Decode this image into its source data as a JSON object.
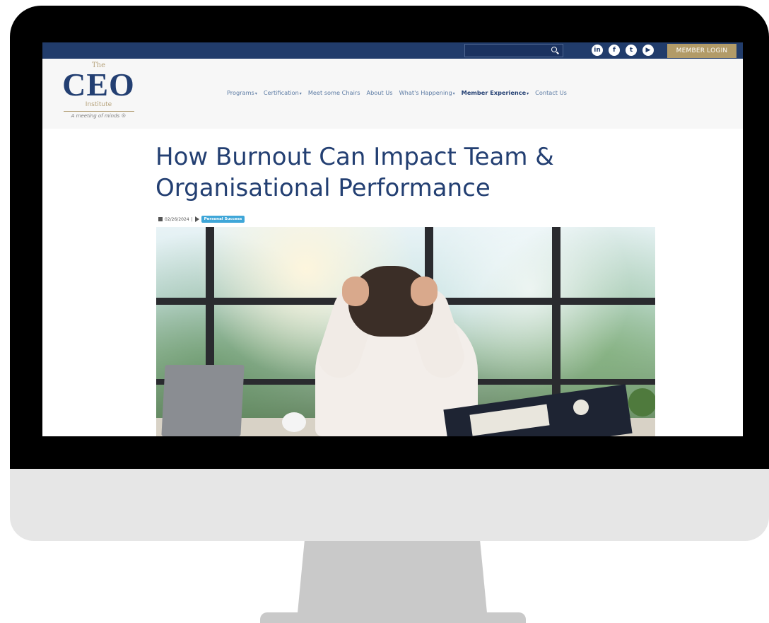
{
  "screen": {
    "search": {
      "placeholder": ""
    },
    "social_icons": [
      {
        "name": "linkedin-icon",
        "glyph": "in"
      },
      {
        "name": "facebook-icon",
        "glyph": "f"
      },
      {
        "name": "twitter-icon",
        "glyph": "t"
      },
      {
        "name": "youtube-icon",
        "glyph": "▶"
      }
    ],
    "member_login_label": "MEMBER LOGIN",
    "logo": {
      "the": "The",
      "ceo": "CEO",
      "institute": "Institute",
      "tagline": "A meeting of minds ®"
    },
    "nav": [
      {
        "label": "Programs",
        "dropdown": true,
        "strong": false
      },
      {
        "label": "Certification",
        "dropdown": true,
        "strong": false
      },
      {
        "label": "Meet some Chairs",
        "dropdown": false,
        "strong": false
      },
      {
        "label": "About Us",
        "dropdown": false,
        "strong": false
      },
      {
        "label": "What's Happening",
        "dropdown": true,
        "strong": false
      },
      {
        "label": "Member Experience",
        "dropdown": true,
        "strong": true
      },
      {
        "label": "Contact Us",
        "dropdown": false,
        "strong": false
      }
    ],
    "article": {
      "title": "How Burnout Can Impact Team & Organisational Performance",
      "date": "02/26/2024",
      "tag": "Personal Success"
    }
  },
  "colors": {
    "top_bar": "#213c6b",
    "member_login_bg": "#b29b68",
    "title": "#233f72",
    "tag_badge": "#3ea6d8"
  }
}
